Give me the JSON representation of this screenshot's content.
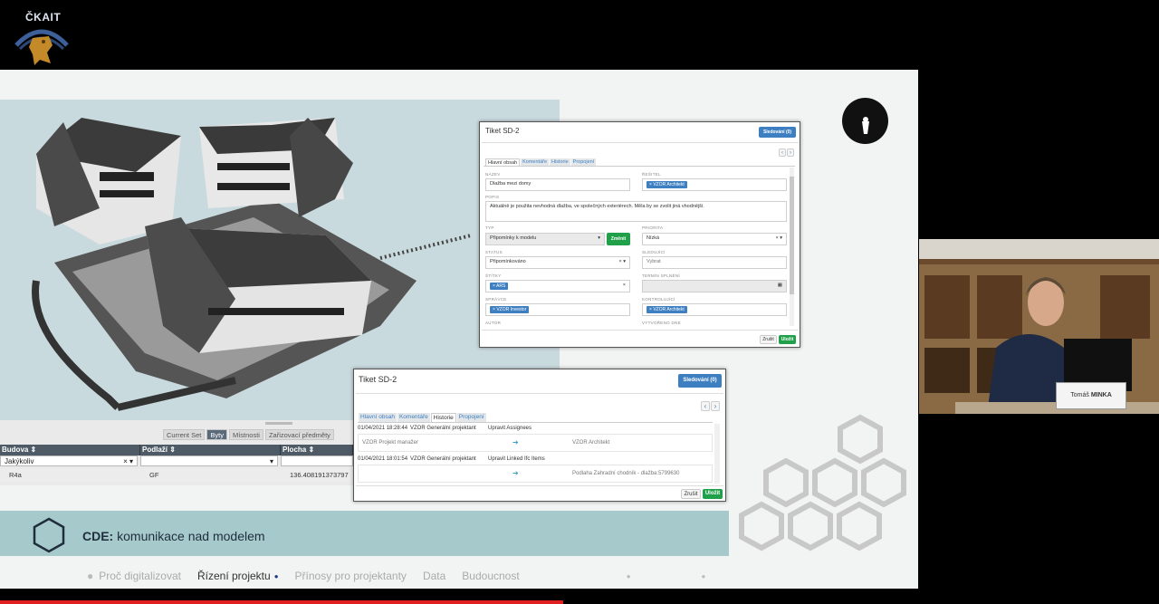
{
  "logo": {
    "text": "ČKAIT"
  },
  "viewer": {
    "tabs": [
      "Current Set",
      "Byty",
      "Místnosti",
      "Zařizovací předměty"
    ],
    "active_tab": "Byty",
    "columns": [
      "Budova ⇕",
      "Podlaží ⇕",
      "Plocha ⇕"
    ],
    "filter_values": [
      "Jakýkoliv",
      "",
      ""
    ],
    "row": [
      "R4a",
      "GF",
      "136.408191373797"
    ]
  },
  "ticket1": {
    "title": "Tiket SD-2",
    "follow_button": "Sledování (0)",
    "tabs": [
      "Hlavní obsah",
      "Komentáře",
      "Historie",
      "Propojení"
    ],
    "labels": {
      "nazev": "NÁZEV",
      "resitel": "ŘEŠITEL",
      "popis": "POPIS",
      "typ": "TYP",
      "priorita": "PRIORITA",
      "status": "STATUS",
      "sledujici": "SLEDUJÍCÍ",
      "stitky": "ŠTÍTKY",
      "termin": "TERMÍN SPLNĚNÍ",
      "spravce": "SPRÁVCE",
      "kontrolujici": "KONTROLUJÍCÍ",
      "autor": "AUTOR",
      "vytvoreno": "VYTVOŘENO DNE"
    },
    "nazev_value": "Dlažba mezi domy",
    "resitel_chip": "VZOR Architekt",
    "popis_value": "Aktuálně je použita nevhodná dlažba, ve společných exteriérech. Měla by se zvolit jiná vhodnější.",
    "typ_value": "Připomínky k modelu",
    "zmenit": "Změnit",
    "priorita_value": "Nízká",
    "status_value": "Připomínkováno",
    "sledujici_value": "Vybrat",
    "stitky_chip": "ARS",
    "spravce_chip": "VZOR Investor",
    "kontrolujici_chip": "VZOR Architekt",
    "zrusit": "Zrušit",
    "ulozit": "Uložit"
  },
  "ticket2": {
    "title": "Tiket SD-2",
    "follow_button": "Sledování (0)",
    "tabs": [
      "Hlavní obsah",
      "Komentáře",
      "Historie",
      "Propojení"
    ],
    "active_tab": "Historie",
    "history": [
      {
        "time": "01/04/2021 18:28:44",
        "user": "VZOR Generální projektant",
        "action": "Upravit Assignees",
        "from": "VZOR Projekt manažer",
        "to": "VZOR Architekt"
      },
      {
        "time": "01/04/2021 18:01:54",
        "user": "VZOR Generální projektant",
        "action": "Upravit Linked Ifc Items",
        "from": "",
        "to": "Podlaha Zahradní chodník - dlažba:5799630"
      }
    ],
    "zrusit": "Zrušit",
    "ulozit": "Uložit"
  },
  "slide": {
    "cde_label": "CDE:",
    "cde_text": "komunikace nad modelem",
    "nav": [
      "Proč digitalizovat",
      "Řízení projektu",
      "Přínosy pro projektanty",
      "Data",
      "Budoucnost"
    ],
    "nav_active": "Řízení projektu"
  },
  "speaker": {
    "first": "Tomáš",
    "last": "MINKA"
  },
  "colors": {
    "teal_bar": "#a6c9cb",
    "accent_blue": "#3d7fc0",
    "save_green": "#1fa049",
    "progress_red": "#e02020"
  }
}
